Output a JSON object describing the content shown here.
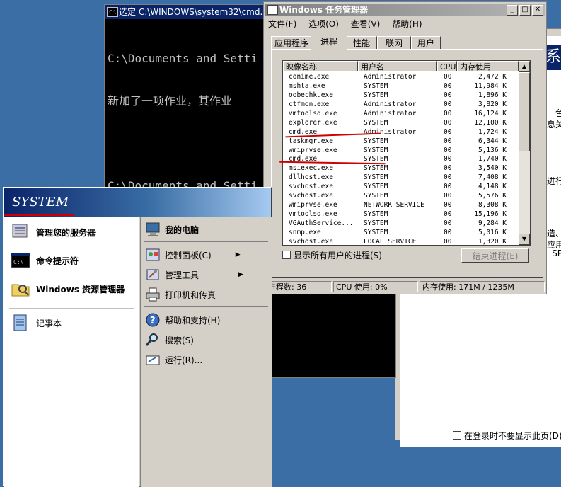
{
  "bg_dialog": {
    "frag_lines": [
      "色",
      "息关",
      "进行",
      "造、",
      "应用",
      "SP."
    ],
    "navy_glyph": "系",
    "checkbox_label": "在登录时不要显示此页(D)"
  },
  "cmd": {
    "title": "选定 C:\\WINDOWS\\system32\\cmd.",
    "lines": [
      "C:\\Documents and Setti",
      "新加了一项作业，其作业",
      "",
      "C:\\Documents and Setti"
    ]
  },
  "taskmgr": {
    "title": "Windows 任务管理器",
    "menu": [
      "文件(F)",
      "选项(O)",
      "查看(V)",
      "帮助(H)"
    ],
    "tabs": [
      "应用程序",
      "进程",
      "性能",
      "联网",
      "用户"
    ],
    "active_tab": "进程",
    "columns": [
      "映像名称",
      "用户名",
      "CPU",
      "内存使用"
    ],
    "processes": [
      {
        "name": "conime.exe",
        "user": "Administrator",
        "cpu": "00",
        "mem": "2,472 K"
      },
      {
        "name": "mshta.exe",
        "user": "SYSTEM",
        "cpu": "00",
        "mem": "11,984 K"
      },
      {
        "name": "oobechk.exe",
        "user": "SYSTEM",
        "cpu": "00",
        "mem": "1,896 K"
      },
      {
        "name": "ctfmon.exe",
        "user": "Administrator",
        "cpu": "00",
        "mem": "3,820 K"
      },
      {
        "name": "vmtoolsd.exe",
        "user": "Administrator",
        "cpu": "00",
        "mem": "16,124 K"
      },
      {
        "name": "explorer.exe",
        "user": "SYSTEM",
        "cpu": "00",
        "mem": "12,100 K"
      },
      {
        "name": "cmd.exe",
        "user": "Administrator",
        "cpu": "00",
        "mem": "1,724 K"
      },
      {
        "name": "taskmgr.exe",
        "user": "SYSTEM",
        "cpu": "00",
        "mem": "6,344 K"
      },
      {
        "name": "wmiprvse.exe",
        "user": "SYSTEM",
        "cpu": "00",
        "mem": "5,136 K"
      },
      {
        "name": "cmd.exe",
        "user": "SYSTEM",
        "cpu": "00",
        "mem": "1,740 K"
      },
      {
        "name": "msiexec.exe",
        "user": "SYSTEM",
        "cpu": "00",
        "mem": "3,540 K"
      },
      {
        "name": "dllhost.exe",
        "user": "SYSTEM",
        "cpu": "00",
        "mem": "7,408 K"
      },
      {
        "name": "svchost.exe",
        "user": "SYSTEM",
        "cpu": "00",
        "mem": "4,148 K"
      },
      {
        "name": "svchost.exe",
        "user": "SYSTEM",
        "cpu": "00",
        "mem": "5,576 K"
      },
      {
        "name": "wmiprvse.exe",
        "user": "NETWORK SERVICE",
        "cpu": "00",
        "mem": "8,308 K"
      },
      {
        "name": "vmtoolsd.exe",
        "user": "SYSTEM",
        "cpu": "00",
        "mem": "15,196 K"
      },
      {
        "name": "VGAuthService...",
        "user": "SYSTEM",
        "cpu": "00",
        "mem": "9,284 K"
      },
      {
        "name": "snmp.exe",
        "user": "SYSTEM",
        "cpu": "00",
        "mem": "5,016 K"
      },
      {
        "name": "svchost.exe",
        "user": "LOCAL SERVICE",
        "cpu": "00",
        "mem": "1,320 K"
      }
    ],
    "show_all_label": "显示所有用户的进程(S)",
    "end_process_label": "结束进程(E)",
    "status": {
      "processes": "进程数: 36",
      "cpu": "CPU 使用: 0%",
      "memory": "内存使用: 171M / 1235M"
    }
  },
  "start_menu": {
    "user": "SYSTEM",
    "left_items": [
      {
        "label": "管理您的服务器",
        "icon": "server-icon"
      },
      {
        "label": "命令提示符",
        "icon": "cmd-icon"
      },
      {
        "label": "Windows 资源管理器",
        "icon": "explorer-icon"
      },
      {
        "label": "记事本",
        "icon": "notepad-icon"
      }
    ],
    "right_items": [
      {
        "label": "我的电脑",
        "icon": "computer-icon"
      },
      {
        "label": "控制面板(C)",
        "icon": "control-panel-icon"
      },
      {
        "label": "管理工具",
        "icon": "admin-tools-icon"
      },
      {
        "label": "打印机和传真",
        "icon": "printer-icon"
      },
      {
        "label": "帮助和支持(H)",
        "icon": "help-icon"
      },
      {
        "label": "搜索(S)",
        "icon": "search-icon"
      },
      {
        "label": "运行(R)...",
        "icon": "run-icon"
      }
    ]
  }
}
